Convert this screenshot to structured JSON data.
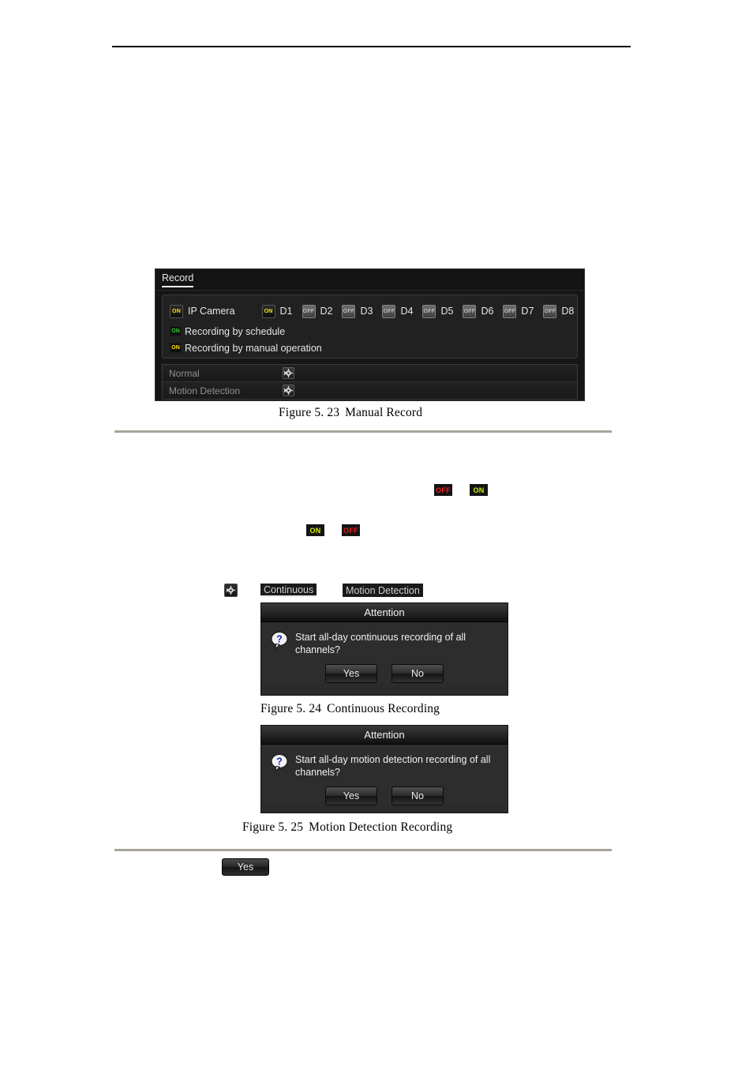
{
  "page": {
    "rules": [
      "header-rule-top",
      "section-rule-after-fig-523",
      "section-rule-after-fig-525"
    ]
  },
  "record_panel": {
    "tab_label": "Record",
    "ip_camera": {
      "label": "IP Camera",
      "toggle_state": "ON"
    },
    "channels": [
      {
        "label": "D1",
        "state": "ON"
      },
      {
        "label": "D2",
        "state": "OFF"
      },
      {
        "label": "D3",
        "state": "OFF"
      },
      {
        "label": "D4",
        "state": "OFF"
      },
      {
        "label": "D5",
        "state": "OFF"
      },
      {
        "label": "D6",
        "state": "OFF"
      },
      {
        "label": "D7",
        "state": "OFF"
      },
      {
        "label": "D8",
        "state": "OFF"
      }
    ],
    "legend": [
      {
        "badge": "ON",
        "badge_color": "#2fd02f",
        "text": "Recording by schedule"
      },
      {
        "badge": "ON",
        "badge_color": "#ffe400",
        "text": "Recording by manual operation"
      }
    ],
    "record_types": [
      {
        "name": "Normal",
        "icon": "gear-icon"
      },
      {
        "name": "Motion Detection",
        "icon": "gear-icon"
      }
    ]
  },
  "inline_images": {
    "badge_off_1": "OFF",
    "badge_on_1": "ON",
    "badge_on_2": "ON",
    "badge_off_2": "OFF",
    "gear_icon_name": "gear-icon",
    "continuous_button": "Continuous",
    "motion_detection_button": "Motion Detection",
    "yes_button": "Yes"
  },
  "dialogs": {
    "continuous": {
      "title": "Attention",
      "icon": "question-icon",
      "message": "Start all-day continuous recording of all channels?",
      "buttons": {
        "yes": "Yes",
        "no": "No"
      }
    },
    "motion": {
      "title": "Attention",
      "icon": "question-icon",
      "message": "Start all-day motion detection recording of all channels?",
      "buttons": {
        "yes": "Yes",
        "no": "No"
      }
    }
  },
  "captions": {
    "fig523": {
      "number": "Figure 5. 23",
      "title": "Manual Record"
    },
    "fig524": {
      "number": "Figure 5. 24",
      "title": "Continuous Recording"
    },
    "fig525": {
      "number": "Figure 5. 25",
      "title": "Motion Detection Recording"
    }
  }
}
